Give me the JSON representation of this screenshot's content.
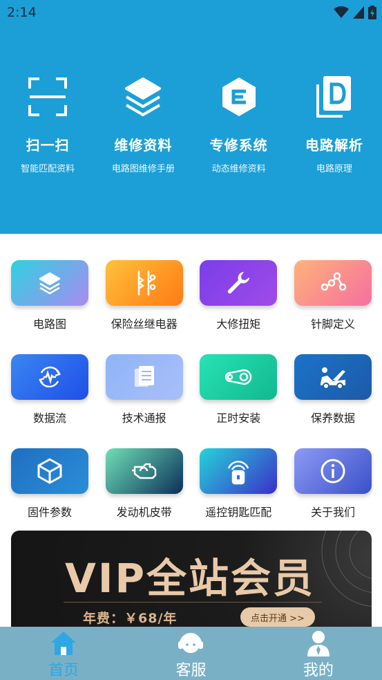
{
  "status": {
    "time": "2:14"
  },
  "quick": [
    {
      "title": "扫一扫",
      "sub": "智能匹配资料",
      "icon": "scan-icon"
    },
    {
      "title": "维修资料",
      "sub": "电路图维修手册",
      "icon": "layers-icon"
    },
    {
      "title": "专修系统",
      "sub": "动态维修资料",
      "icon": "hexagon-e-icon"
    },
    {
      "title": "电路解析",
      "sub": "电路原理",
      "icon": "document-d-icon"
    }
  ],
  "grid": [
    {
      "label": "电路图",
      "icon": "layers-icon",
      "colors": [
        "#2fd1e0",
        "#a98bf0"
      ]
    },
    {
      "label": "保险丝继电器",
      "icon": "fuse-relay-icon",
      "colors": [
        "#ffc13b",
        "#ff7b14"
      ]
    },
    {
      "label": "大修扭矩",
      "icon": "wrench-icon",
      "colors": [
        "#7a3ee8",
        "#9f4be8"
      ]
    },
    {
      "label": "针脚定义",
      "icon": "nodes-icon",
      "colors": [
        "#ffb27a",
        "#f56fa0"
      ]
    },
    {
      "label": "数据流",
      "icon": "data-flow-icon",
      "colors": [
        "#3a86f2",
        "#1f4fe8"
      ]
    },
    {
      "label": "技术通报",
      "icon": "documents-icon",
      "colors": [
        "#8fb4f7",
        "#a9bff8"
      ]
    },
    {
      "label": "正时安装",
      "icon": "timing-belt-icon",
      "colors": [
        "#27e3b6",
        "#12b88e"
      ]
    },
    {
      "label": "保养数据",
      "icon": "car-service-icon",
      "colors": [
        "#1a73c8",
        "#1e5aa8"
      ]
    },
    {
      "label": "固件参数",
      "icon": "cube-icon",
      "colors": [
        "#1f6fc1",
        "#2a8ed8"
      ]
    },
    {
      "label": "发动机皮带",
      "icon": "engine-icon",
      "colors": [
        "#6fe0b6",
        "#0b2f5a"
      ]
    },
    {
      "label": "遥控钥匙匹配",
      "icon": "remote-key-icon",
      "colors": [
        "#25d4d9",
        "#3b2fc9"
      ]
    },
    {
      "label": "关于我们",
      "icon": "info-icon",
      "colors": [
        "#8d9af5",
        "#3a50c8"
      ]
    }
  ],
  "vip": {
    "title": "VIP全站会员",
    "fee": "年费：￥68/年",
    "button": "点击开通 >>"
  },
  "nav": [
    {
      "label": "首页",
      "icon": "home-icon",
      "active": true
    },
    {
      "label": "客服",
      "icon": "headset-icon",
      "active": false
    },
    {
      "label": "我的",
      "icon": "user-icon",
      "active": false
    }
  ],
  "colors": {
    "header": "#1b9fd6",
    "nav_bg": "#7ab0c6",
    "nav_active": "#2ea7e5"
  }
}
